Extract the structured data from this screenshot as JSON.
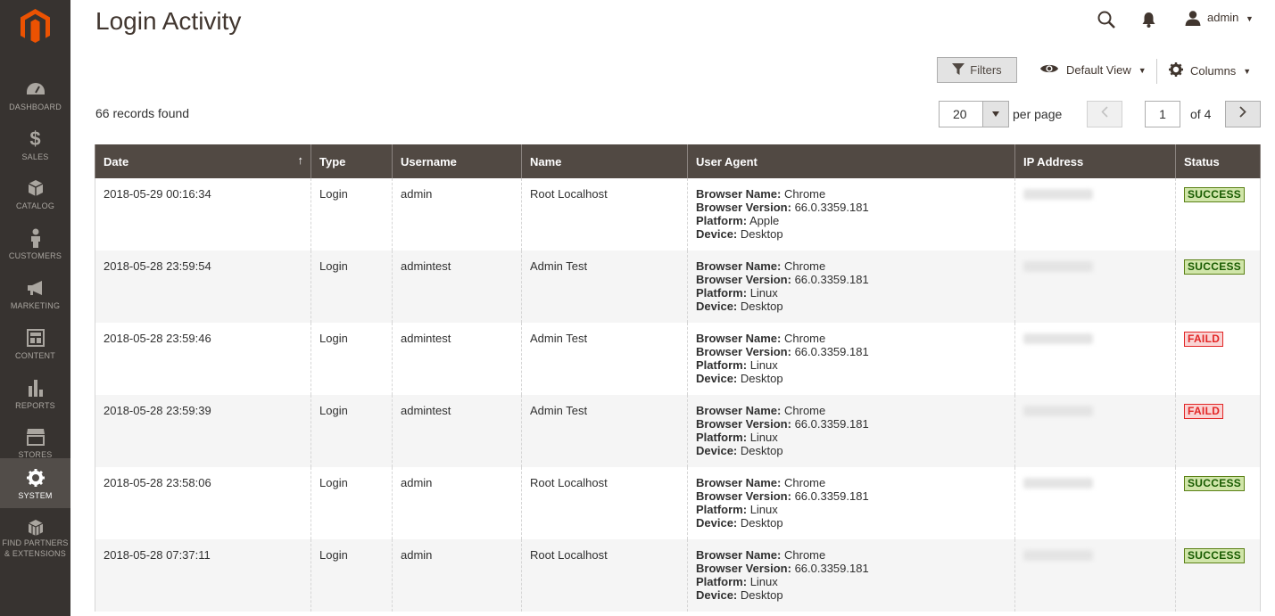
{
  "sidebar": {
    "items": [
      {
        "label": "DASHBOARD",
        "icon": "dashboard-icon"
      },
      {
        "label": "SALES",
        "icon": "dollar-icon"
      },
      {
        "label": "CATALOG",
        "icon": "box-icon"
      },
      {
        "label": "CUSTOMERS",
        "icon": "person-icon"
      },
      {
        "label": "MARKETING",
        "icon": "megaphone-icon"
      },
      {
        "label": "CONTENT",
        "icon": "layout-icon"
      },
      {
        "label": "REPORTS",
        "icon": "bar-chart-icon"
      },
      {
        "label": "STORES",
        "icon": "storefront-icon"
      },
      {
        "label": "SYSTEM",
        "icon": "gear-icon"
      },
      {
        "label": "FIND PARTNERS & EXTENSIONS",
        "icon": "cubes-icon"
      }
    ],
    "active": "SYSTEM"
  },
  "header": {
    "title": "Login Activity",
    "user": "admin"
  },
  "toolbar": {
    "filters": "Filters",
    "view": "Default View",
    "columns": "Columns",
    "records_found": "66 records found",
    "per_page_value": "20",
    "per_page_label": "per page",
    "page_current": "1",
    "page_of": "of 4"
  },
  "grid": {
    "columns": [
      "Date",
      "Type",
      "Username",
      "Name",
      "User Agent",
      "IP Address",
      "Status"
    ],
    "ua_keys": {
      "browser_name": "Browser Name:",
      "browser_version": "Browser Version:",
      "platform": "Platform:",
      "device": "Device:"
    },
    "rows": [
      {
        "date": "2018-05-29 00:16:34",
        "type": "Login",
        "username": "admin",
        "name": "Root Localhost",
        "browser_name": "Chrome",
        "browser_version": "66.0.3359.181",
        "platform": "Apple",
        "device": "Desktop",
        "status": "SUCCESS"
      },
      {
        "date": "2018-05-28 23:59:54",
        "type": "Login",
        "username": "admintest",
        "name": "Admin Test",
        "browser_name": "Chrome",
        "browser_version": "66.0.3359.181",
        "platform": "Linux",
        "device": "Desktop",
        "status": "SUCCESS"
      },
      {
        "date": "2018-05-28 23:59:46",
        "type": "Login",
        "username": "admintest",
        "name": "Admin Test",
        "browser_name": "Chrome",
        "browser_version": "66.0.3359.181",
        "platform": "Linux",
        "device": "Desktop",
        "status": "FAILD"
      },
      {
        "date": "2018-05-28 23:59:39",
        "type": "Login",
        "username": "admintest",
        "name": "Admin Test",
        "browser_name": "Chrome",
        "browser_version": "66.0.3359.181",
        "platform": "Linux",
        "device": "Desktop",
        "status": "FAILD"
      },
      {
        "date": "2018-05-28 23:58:06",
        "type": "Login",
        "username": "admin",
        "name": "Root Localhost",
        "browser_name": "Chrome",
        "browser_version": "66.0.3359.181",
        "platform": "Linux",
        "device": "Desktop",
        "status": "SUCCESS"
      },
      {
        "date": "2018-05-28 07:37:11",
        "type": "Login",
        "username": "admin",
        "name": "Root Localhost",
        "browser_name": "Chrome",
        "browser_version": "66.0.3359.181",
        "platform": "Linux",
        "device": "Desktop",
        "status": "SUCCESS"
      }
    ]
  },
  "colors": {
    "sidebar_bg": "#373330",
    "sidebar_active": "#524d49",
    "brand": "#eb5202",
    "header_row": "#514943",
    "success": "#185b00",
    "fail": "#e22626"
  }
}
